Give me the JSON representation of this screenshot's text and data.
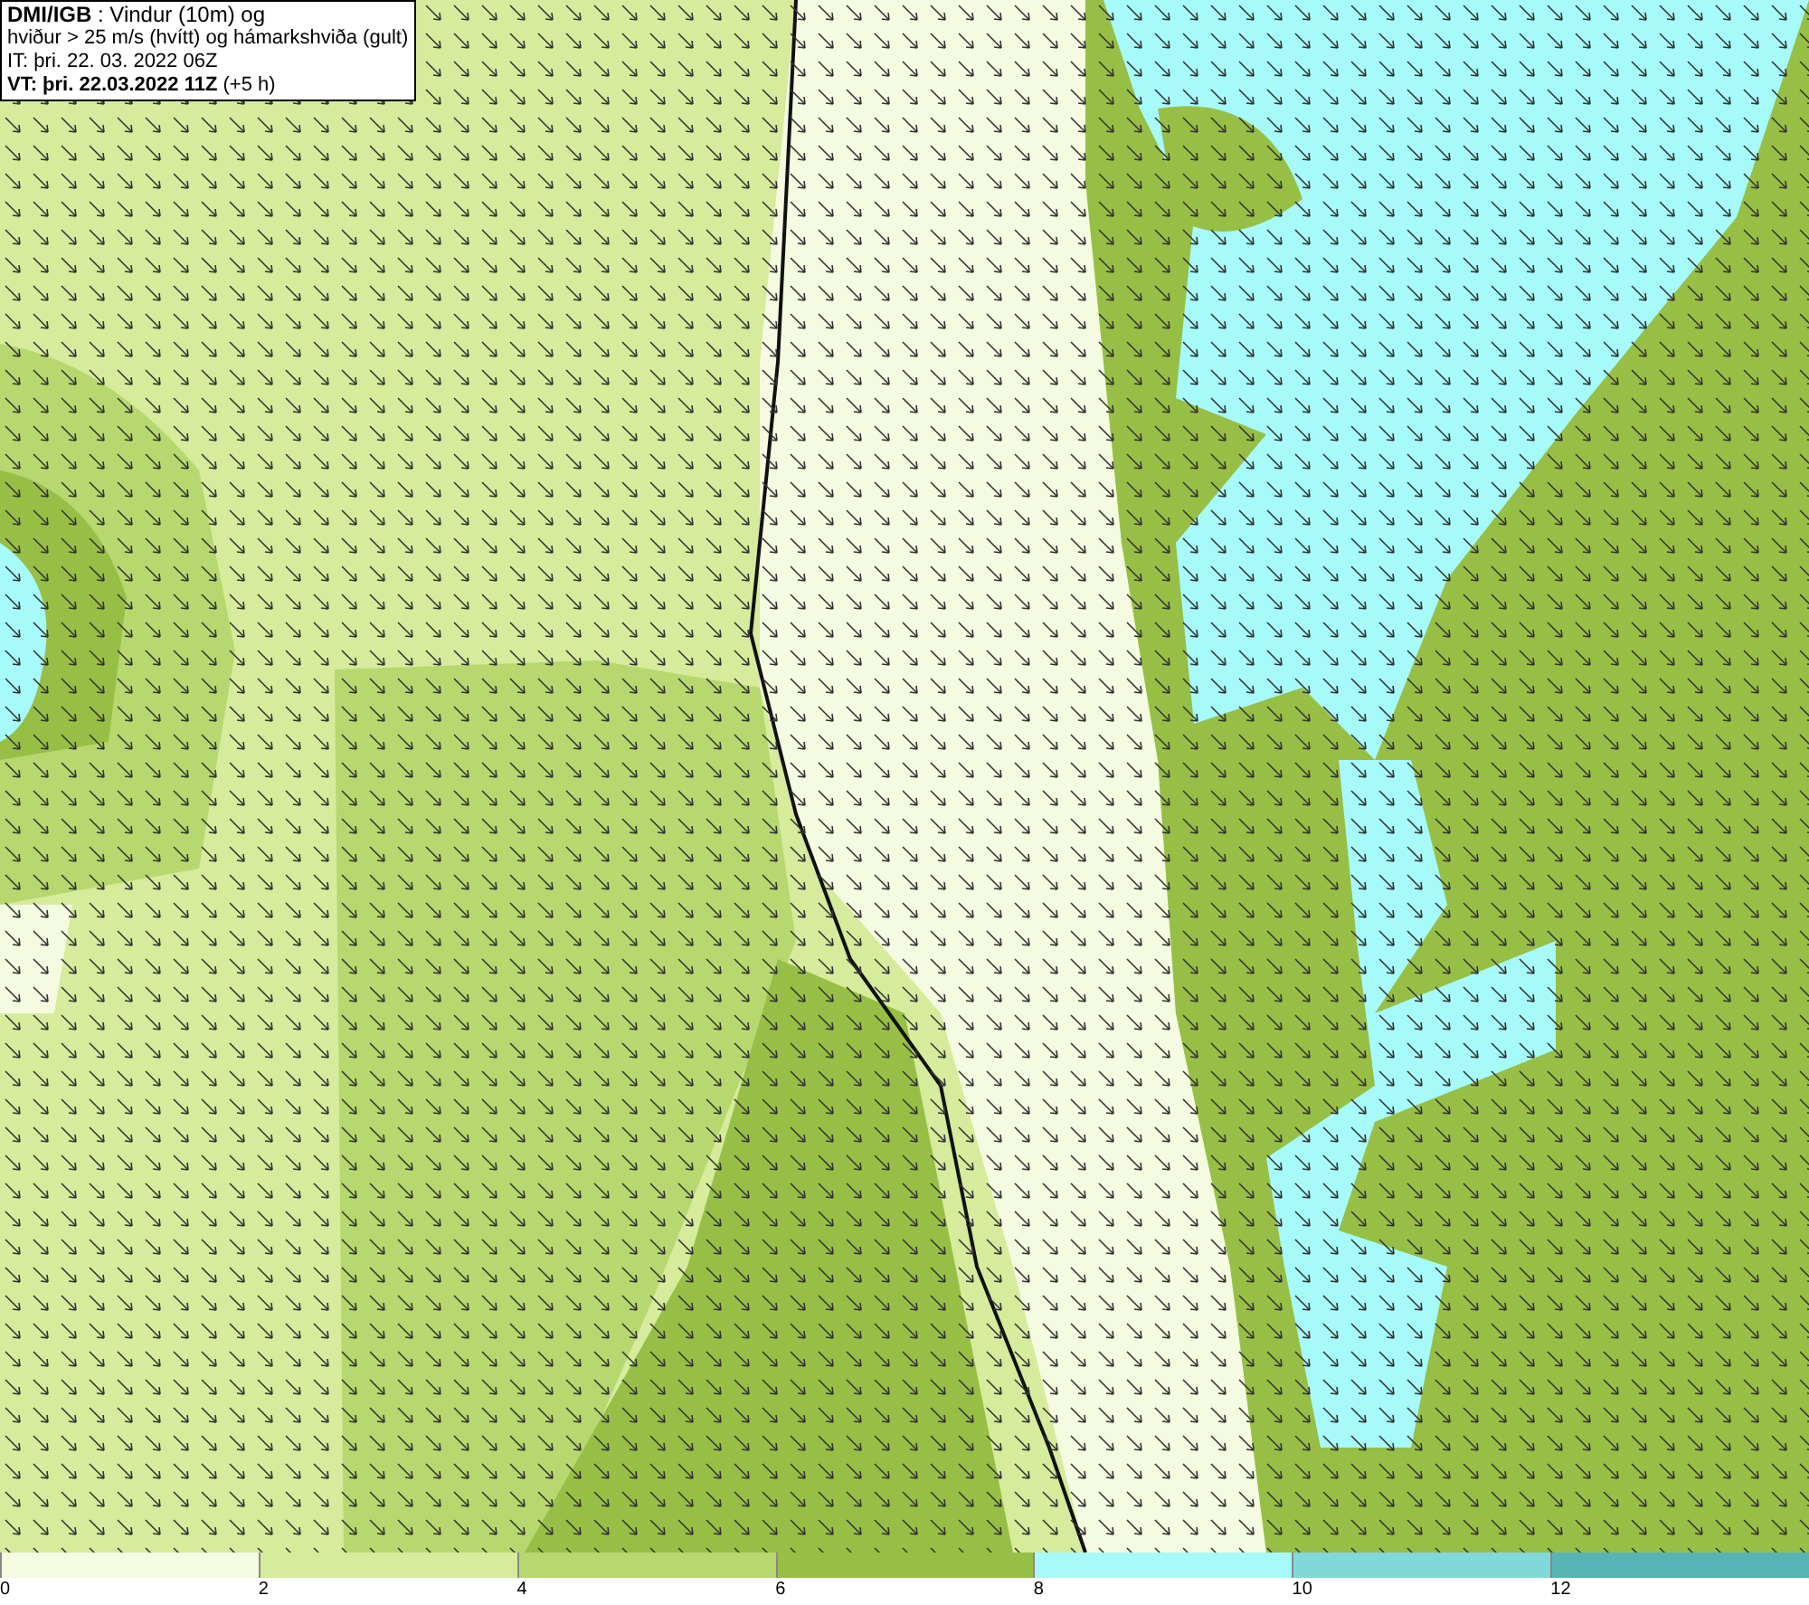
{
  "legend": {
    "lines": [
      "**DMI/IGB** : Vindur (10m) og",
      "hviður > 25 m/s (hvítt) og hámarkshviða (gult)",
      "IT: þri. 22. 03. 2022 06Z",
      "**VT: þri. 22.03.2022 11Z** (+5 h)"
    ]
  },
  "color_scale": {
    "segments": [
      {
        "color": "#f4fbe0"
      },
      {
        "color": "#d6eb9c"
      },
      {
        "color": "#b6d86e"
      },
      {
        "color": "#97bf45"
      },
      {
        "color": "#a6fafa"
      },
      {
        "color": "#80d8d8"
      },
      {
        "color": "#57b4b4"
      }
    ],
    "ticks": [
      "0",
      "2",
      "4",
      "6",
      "8",
      "10",
      "12"
    ]
  }
}
